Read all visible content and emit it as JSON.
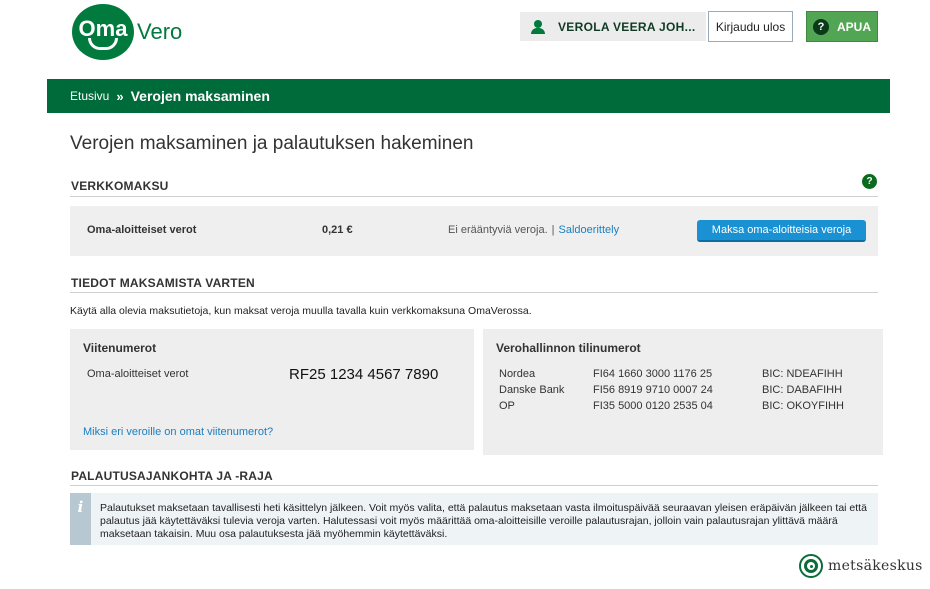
{
  "header": {
    "logo_main": "Oma",
    "logo_sub": "Vero",
    "user_name": "VEROLA VEERA JOH...",
    "logout_label": "Kirjaudu ulos",
    "help_label": "APUA",
    "help_icon_glyph": "?"
  },
  "breadcrumb": {
    "home": "Etusivu",
    "separator": "»",
    "current": "Verojen maksaminen"
  },
  "page_title": "Verojen maksaminen ja palautuksen hakeminen",
  "online_payment": {
    "section_title": "VERKKOMAKSU",
    "help_glyph": "?",
    "row_label": "Oma-aloitteiset verot",
    "amount": "0,21 €",
    "status_text": "Ei erääntyviä veroja.",
    "separator": "|",
    "balance_link": "Saldoerittely",
    "pay_button": "Maksa oma-aloitteisia veroja"
  },
  "payment_info": {
    "section_title": "TIEDOT MAKSAMISTA VARTEN",
    "instructions": "Käytä alla olevia maksutietoja, kun maksat veroja muulla tavalla kuin verkkomaksuna OmaVerossa.",
    "reference": {
      "heading": "Viitenumerot",
      "tax_name": "Oma-aloitteiset verot",
      "reference_number": "RF25 1234 4567 7890",
      "why_link": "Miksi eri veroille on omat viitenumerot?"
    },
    "accounts": {
      "heading": "Verohallinnon tilinumerot",
      "rows": [
        {
          "bank": "Nordea",
          "iban": "FI64 1660 3000 1176 25",
          "bic": "BIC: NDEAFIHH"
        },
        {
          "bank": "Danske Bank",
          "iban": "FI56 8919 9710 0007 24",
          "bic": "BIC: DABAFIHH"
        },
        {
          "bank": "OP",
          "iban": "FI35 5000 0120 2535 04",
          "bic": "BIC: OKOYFIHH"
        }
      ]
    }
  },
  "refund": {
    "section_title": "PALAUTUSAJANKOHTA JA -RAJA",
    "info_glyph": "i",
    "text": "Palautukset maksetaan tavallisesti heti käsittelyn jälkeen. Voit myös valita, että palautus maksetaan vasta ilmoituspäivää seuraavan yleisen eräpäivän jälkeen tai että palautus jää käytettäväksi tulevia veroja varten. Halutessasi voit myös määrittää oma-aloitteisille veroille palautusrajan, jolloin vain palautusrajan ylittävä määrä maksetaan takaisin. Muu osa palautuksesta jää myöhemmin käytettäväksi."
  },
  "footer_brand": "metsäkeskus",
  "colors": {
    "brand_green": "#006b3a",
    "help_green": "#52a552",
    "link_blue": "#1a7fc1",
    "button_blue": "#1991d2"
  }
}
